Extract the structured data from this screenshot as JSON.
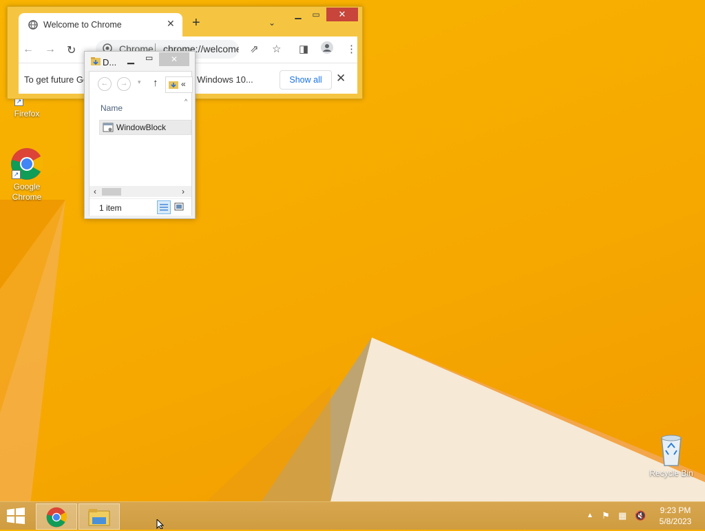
{
  "desktop": {
    "icons": [
      {
        "label": "Firefox"
      },
      {
        "label": "Google Chrome"
      },
      {
        "label": "Recycle Bin"
      }
    ]
  },
  "chrome": {
    "tab_title": "Welcome to Chrome",
    "chip_text": "Chrome",
    "url": "chrome://welcome",
    "infobar_message": "To get future Go",
    "infobar_message_tail": "ll need Windows 10...",
    "show_all_label": "Show all"
  },
  "explorer": {
    "title": "D...",
    "column_name": "Name",
    "items": [
      {
        "name": "WindowBlock"
      }
    ],
    "status": "1 item"
  },
  "taskbar": {
    "time": "9:23 PM",
    "date": "5/8/2023"
  },
  "icons": [
    "globe-icon",
    "close-icon",
    "plus-icon",
    "chevron-down-icon",
    "back-icon",
    "forward-icon",
    "reload-icon",
    "share-icon",
    "star-icon",
    "sidepanel-icon",
    "profile-icon",
    "more-icon",
    "folder-icon",
    "up-arrow-icon",
    "windows-logo-icon",
    "flag-icon",
    "network-icon",
    "volume-muted-icon"
  ]
}
